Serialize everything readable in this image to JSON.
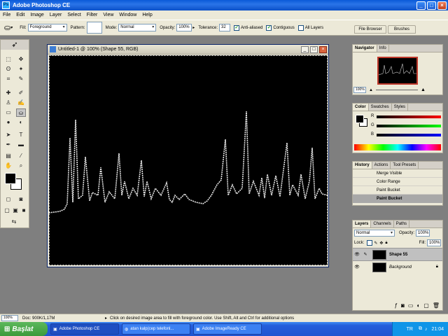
{
  "app": {
    "title": "Adobe Photoshop CE"
  },
  "menu": [
    "File",
    "Edit",
    "Image",
    "Layer",
    "Select",
    "Filter",
    "View",
    "Window",
    "Help"
  ],
  "options": {
    "fill_label": "Fill:",
    "fill_value": "Foreground",
    "pattern_label": "Pattern:",
    "mode_label": "Mode:",
    "mode_value": "Normal",
    "opacity_label": "Opacity:",
    "opacity_value": "100%",
    "tolerance_label": "Tolerance:",
    "tolerance_value": "32",
    "antialiased": "Anti-aliased",
    "contiguous": "Contiguous",
    "all_layers": "All Layers"
  },
  "wells": [
    "File Browser",
    "Brushes"
  ],
  "document": {
    "title": "Untitled-1 @ 100% (Shape 55, RGB)"
  },
  "navigator": {
    "tabs": [
      "Navigator",
      "Info"
    ],
    "zoom": "100%"
  },
  "color": {
    "tabs": [
      "Color",
      "Swatches",
      "Styles"
    ],
    "r": "R",
    "g": "G",
    "b": "B"
  },
  "history": {
    "tabs": [
      "History",
      "Actions",
      "Tool Presets"
    ],
    "items": [
      "Merge Visible",
      "Color Range",
      "Paint Bucket",
      "Paint Bucket"
    ]
  },
  "layers": {
    "tabs": [
      "Layers",
      "Channels",
      "Paths"
    ],
    "mode": "Normal",
    "opacity_label": "Opacity:",
    "opacity_value": "100%",
    "lock_label": "Lock:",
    "fill_label": "Fill:",
    "fill_value": "100%",
    "items": [
      "Shape 55",
      "Background"
    ]
  },
  "status": {
    "zoom": "100%",
    "doc": "Doc: 900K/1,17M",
    "hint": "Click on desired image area to fill with foreground color.  Use Shift, Alt and Ctrl for additional options"
  },
  "taskbar": {
    "start": "Başlat",
    "items": [
      "Adobe Photoshop CE",
      "atan kalp(cep telefonl...",
      "Adobe ImageReady CE"
    ],
    "lang": "TR",
    "time": "21:04"
  },
  "colors": {
    "title_blue": "#0a5ad8",
    "panel_bg": "#ece9d8",
    "workspace": "#7f7f7f"
  }
}
